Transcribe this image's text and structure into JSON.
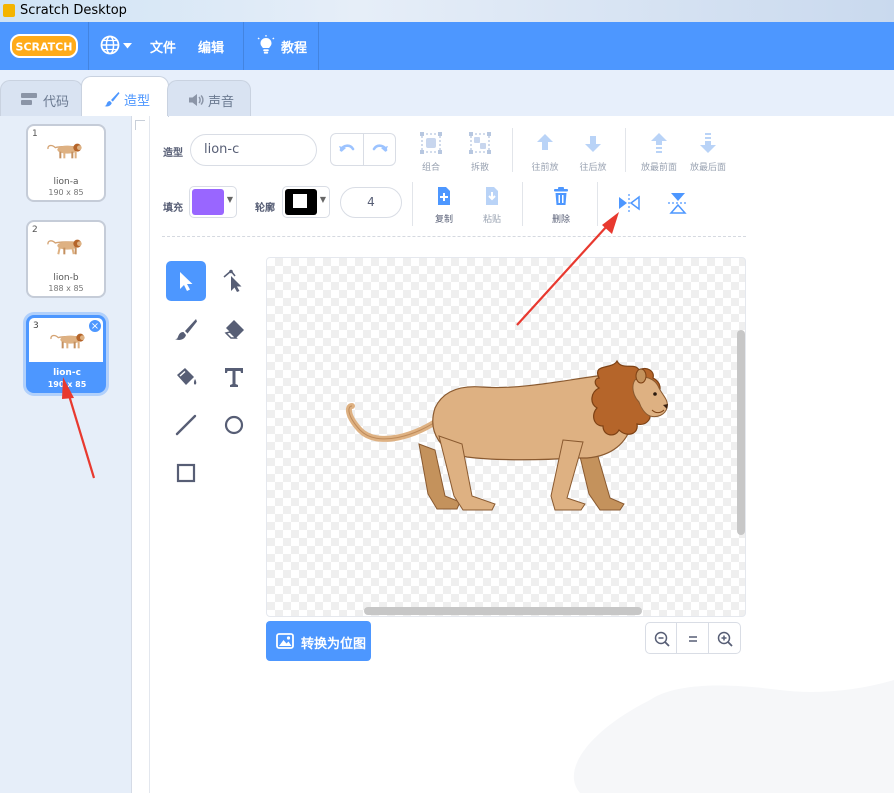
{
  "window": {
    "title": "Scratch Desktop"
  },
  "menubar": {
    "logo_text": "SCRATCH",
    "items": [
      {
        "label": "文件"
      },
      {
        "label": "编辑"
      },
      {
        "label": "教程"
      }
    ]
  },
  "tabs": [
    {
      "label": "代码",
      "icon": "code-icon",
      "active": false
    },
    {
      "label": "造型",
      "icon": "brush-icon",
      "active": true
    },
    {
      "label": "声音",
      "icon": "speaker-icon",
      "active": false
    }
  ],
  "costumes": [
    {
      "number": "1",
      "name": "lion-a",
      "size": "190 x 85",
      "selected": false
    },
    {
      "number": "2",
      "name": "lion-b",
      "size": "188 x 85",
      "selected": false
    },
    {
      "number": "3",
      "name": "lion-c",
      "size": "190 x 85",
      "selected": true
    }
  ],
  "editor": {
    "costume_label": "造型",
    "costume_name": "lion-c",
    "fill_label": "填充",
    "outline_label": "轮廓",
    "outline_width": "4",
    "fill_color": "#9966ff",
    "outline_color": "#000000",
    "buttons": {
      "group": "组合",
      "ungroup": "拆散",
      "forward": "往前放",
      "backward": "往后放",
      "front": "放最前面",
      "back": "放最后面",
      "copy": "复制",
      "paste": "粘贴",
      "delete": "删除"
    },
    "convert_label": "转换为位图",
    "accent_color": "#4d97ff"
  }
}
